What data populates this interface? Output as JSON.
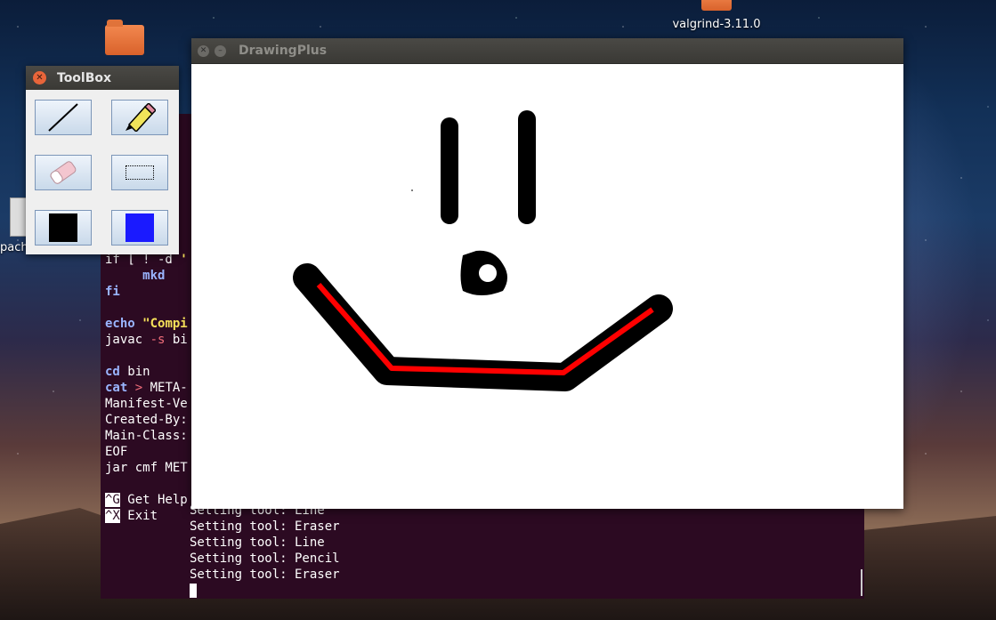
{
  "desktop": {
    "icons": [
      {
        "label": "",
        "icon": "folder-icon"
      },
      {
        "label": "valgrind-3.11.0",
        "icon": "folder-icon"
      }
    ],
    "side_label": "pach"
  },
  "terminal": {
    "code_lines": [
      {
        "parts": [
          {
            "t": "if [ ! -d ",
            "c": ""
          },
          {
            "t": "'",
            "c": "str"
          }
        ]
      },
      {
        "parts": [
          {
            "t": "     mkd",
            "c": "kw"
          }
        ]
      },
      {
        "parts": [
          {
            "t": "fi",
            "c": "kw"
          }
        ]
      },
      {
        "parts": [
          {
            "t": "",
            "c": ""
          }
        ]
      },
      {
        "parts": [
          {
            "t": "echo ",
            "c": "kw"
          },
          {
            "t": "\"Compi",
            "c": "str"
          }
        ]
      },
      {
        "parts": [
          {
            "t": "javac ",
            "c": ""
          },
          {
            "t": "-s",
            "c": "op"
          },
          {
            "t": " bi",
            "c": ""
          }
        ]
      },
      {
        "parts": [
          {
            "t": "",
            "c": ""
          }
        ]
      },
      {
        "parts": [
          {
            "t": "cd",
            "c": "kw"
          },
          {
            "t": " bin",
            "c": ""
          }
        ]
      },
      {
        "parts": [
          {
            "t": "cat",
            "c": "kw"
          },
          {
            "t": " > ",
            "c": "op"
          },
          {
            "t": "META-",
            "c": ""
          }
        ]
      },
      {
        "parts": [
          {
            "t": "Manifest-Ve",
            "c": ""
          }
        ]
      },
      {
        "parts": [
          {
            "t": "Created-By:",
            "c": ""
          }
        ]
      },
      {
        "parts": [
          {
            "t": "Main-Class:",
            "c": ""
          }
        ]
      },
      {
        "parts": [
          {
            "t": "EOF",
            "c": ""
          }
        ]
      },
      {
        "parts": [
          {
            "t": "jar cmf MET",
            "c": ""
          }
        ]
      },
      {
        "parts": [
          {
            "t": "",
            "c": ""
          }
        ]
      }
    ],
    "shortcuts": [
      {
        "key": "^G",
        "label": "Get Help"
      },
      {
        "key": "^X",
        "label": "Exit"
      }
    ],
    "output_lines": [
      "Setting tool: Line",
      "Setting tool: Eraser",
      "Setting tool: Line",
      "Setting tool: Pencil",
      "Setting tool: Eraser"
    ]
  },
  "drawing_window": {
    "title": "DrawingPlus"
  },
  "toolbox": {
    "title": "ToolBox",
    "tools": [
      {
        "name": "line-tool",
        "icon": "line-icon"
      },
      {
        "name": "pencil-tool",
        "icon": "pencil-icon"
      },
      {
        "name": "eraser-tool",
        "icon": "eraser-icon"
      },
      {
        "name": "select-tool",
        "icon": "selection-rectangle-icon"
      },
      {
        "name": "primary-color",
        "icon": "color-swatch-icon",
        "color": "#000000"
      },
      {
        "name": "secondary-color",
        "icon": "color-swatch-icon",
        "color": "#1a1aff"
      }
    ]
  }
}
